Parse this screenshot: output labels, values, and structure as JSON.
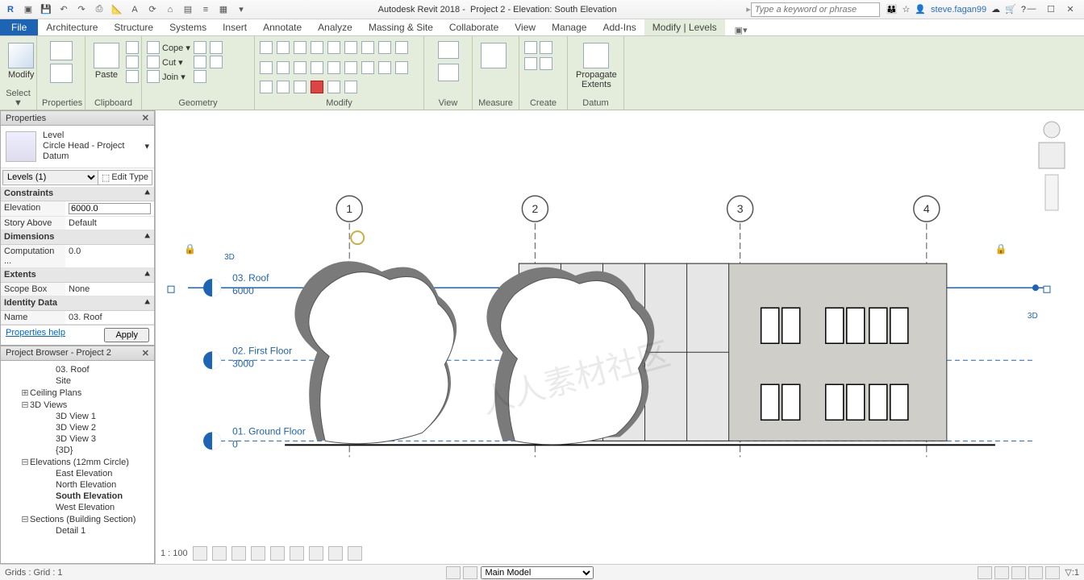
{
  "app": {
    "title": "Autodesk Revit 2018 -",
    "project": "Project 2 - Elevation: South Elevation",
    "user": "steve.fagan99",
    "search_placeholder": "Type a keyword or phrase"
  },
  "menu": {
    "file": "File",
    "tabs": [
      "Architecture",
      "Structure",
      "Systems",
      "Insert",
      "Annotate",
      "Analyze",
      "Massing & Site",
      "Collaborate",
      "View",
      "Manage",
      "Add-Ins",
      "Modify | Levels"
    ]
  },
  "ribbon": {
    "select": {
      "modify": "Modify",
      "label": "Select ▼",
      "props": "Properties"
    },
    "clipboard": {
      "paste": "Paste",
      "label": "Clipboard"
    },
    "geometry": {
      "cope": "Cope  ▾",
      "cut": "Cut  ▾",
      "join": "Join  ▾",
      "label": "Geometry"
    },
    "modify": {
      "label": "Modify"
    },
    "view": {
      "label": "View"
    },
    "measure": {
      "label": "Measure"
    },
    "create": {
      "label": "Create"
    },
    "datum": {
      "propagate": "Propagate\nExtents",
      "label": "Datum"
    }
  },
  "properties": {
    "title": "Properties",
    "type_line1": "Level",
    "type_line2": "Circle Head - Project",
    "type_line3": "Datum",
    "selector": "Levels (1)",
    "edit_type": "Edit Type",
    "cats": {
      "constraints": "Constraints",
      "dimensions": "Dimensions",
      "extents": "Extents",
      "identity": "Identity Data"
    },
    "fields": {
      "elevation_k": "Elevation",
      "elevation_v": "6000.0",
      "story_k": "Story Above",
      "story_v": "Default",
      "comp_k": "Computation ...",
      "comp_v": "0.0",
      "scope_k": "Scope Box",
      "scope_v": "None",
      "name_k": "Name",
      "name_v": "03. Roof"
    },
    "help": "Properties help",
    "apply": "Apply"
  },
  "browser": {
    "title": "Project Browser - Project 2",
    "nodes": {
      "roof": "03. Roof",
      "site": "Site",
      "ceiling": "Ceiling Plans",
      "views3d": "3D Views",
      "v1": "3D View 1",
      "v2": "3D View 2",
      "v3": "3D View 3",
      "v4": "{3D}",
      "elev": "Elevations (12mm Circle)",
      "east": "East Elevation",
      "north": "North Elevation",
      "south": "South Elevation",
      "west": "West Elevation",
      "sections": "Sections (Building Section)",
      "d1": "Detail 1"
    }
  },
  "drawing": {
    "grids": [
      "1",
      "2",
      "3",
      "4"
    ],
    "levels": [
      {
        "name": "03. Roof",
        "val": "6000"
      },
      {
        "name": "02. First Floor",
        "val": "3000"
      },
      {
        "name": "01. Ground Floor",
        "val": "0"
      }
    ],
    "scale": "1 : 100",
    "tag3d": "3D"
  },
  "status": {
    "left": "Grids : Grid : 1",
    "model": "Main Model"
  }
}
